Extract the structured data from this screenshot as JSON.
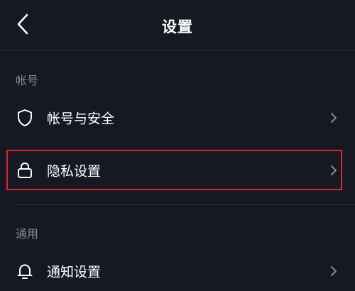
{
  "header": {
    "title": "设置",
    "back_icon": "chevron-left-icon"
  },
  "sections": [
    {
      "label": "帐号",
      "items": [
        {
          "label": "帐号与安全",
          "icon": "shield-icon"
        },
        {
          "label": "隐私设置",
          "icon": "lock-icon",
          "highlighted": true
        }
      ]
    },
    {
      "label": "通用",
      "items": [
        {
          "label": "通知设置",
          "icon": "bell-icon"
        }
      ]
    }
  ],
  "colors": {
    "background": "#161823",
    "text_primary": "#ffffff",
    "text_secondary": "#8a8b91",
    "divider": "#2a2c37",
    "highlight_border": "#d42a2a"
  }
}
